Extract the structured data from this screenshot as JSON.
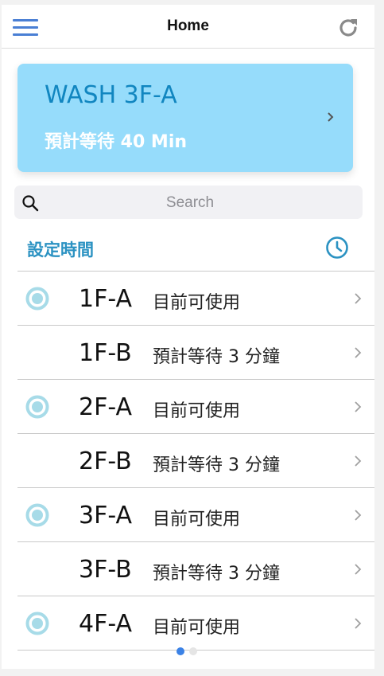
{
  "header": {
    "title": "Home",
    "menu_icon": "hamburger-menu-icon",
    "refresh_icon": "refresh-icon"
  },
  "banner": {
    "title": "WASH 3F-A",
    "subtitle": "預計等待 40 Min"
  },
  "search": {
    "placeholder": "Search",
    "value": ""
  },
  "section": {
    "title": "設定時間",
    "icon": "clock-icon"
  },
  "machines": [
    {
      "code": "1F-A",
      "status": "目前可使用",
      "available": true
    },
    {
      "code": "1F-B",
      "status": "預計等待 3 分鐘",
      "available": false
    },
    {
      "code": "2F-A",
      "status": "目前可使用",
      "available": true
    },
    {
      "code": "2F-B",
      "status": "預計等待 3 分鐘",
      "available": false
    },
    {
      "code": "3F-A",
      "status": "目前可使用",
      "available": true
    },
    {
      "code": "3F-B",
      "status": "預計等待 3 分鐘",
      "available": false
    },
    {
      "code": "4F-A",
      "status": "目前可使用",
      "available": true
    }
  ],
  "pagination": {
    "pages": 2,
    "current": 1
  },
  "colors": {
    "accent": "#4a7fd4",
    "banner_bg": "#96dcfb",
    "banner_title": "#1186c0",
    "section_title": "#2b92c2",
    "radio": "#a7dbe8",
    "dot_active": "#3b82e6",
    "dot_inactive": "#e5e5e5"
  }
}
